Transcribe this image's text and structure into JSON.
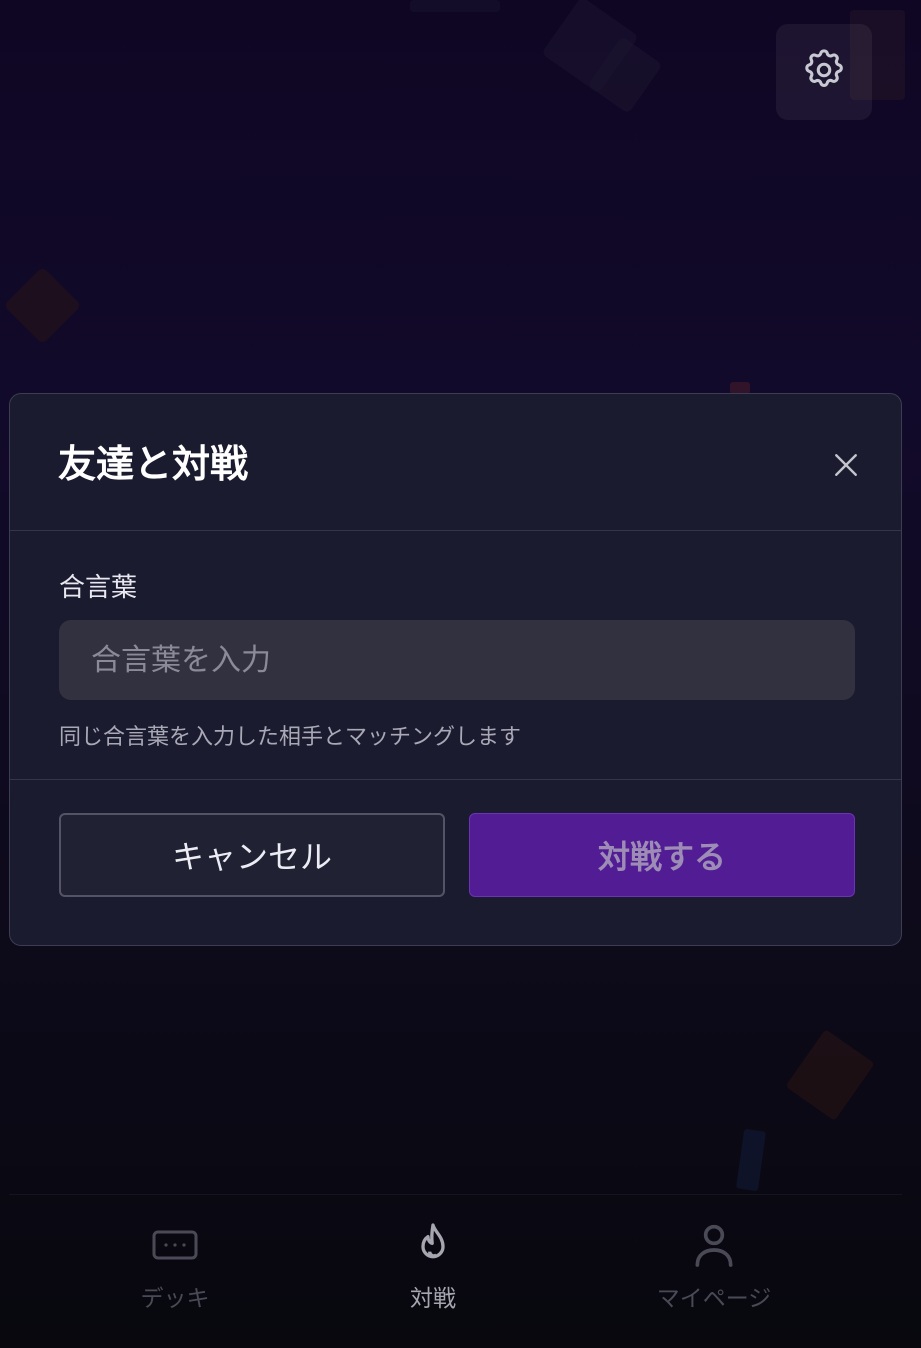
{
  "settings": {
    "icon": "gear-icon"
  },
  "modal": {
    "title": "友達と対戦",
    "close_icon": "close-icon",
    "field_label": "合言葉",
    "input_placeholder": "合言葉を入力",
    "input_value": "",
    "helper_text": "同じ合言葉を入力した相手とマッチングします",
    "cancel_label": "キャンセル",
    "submit_label": "対戦する"
  },
  "nav": {
    "items": [
      {
        "label": "デッキ",
        "icon": "card-icon",
        "active": false
      },
      {
        "label": "対戦",
        "icon": "flame-icon",
        "active": true
      },
      {
        "label": "マイページ",
        "icon": "user-icon",
        "active": false
      }
    ]
  },
  "colors": {
    "primary": "#521c94",
    "modal_bg": "#1b1b2f",
    "page_bg": "#0f0624"
  }
}
